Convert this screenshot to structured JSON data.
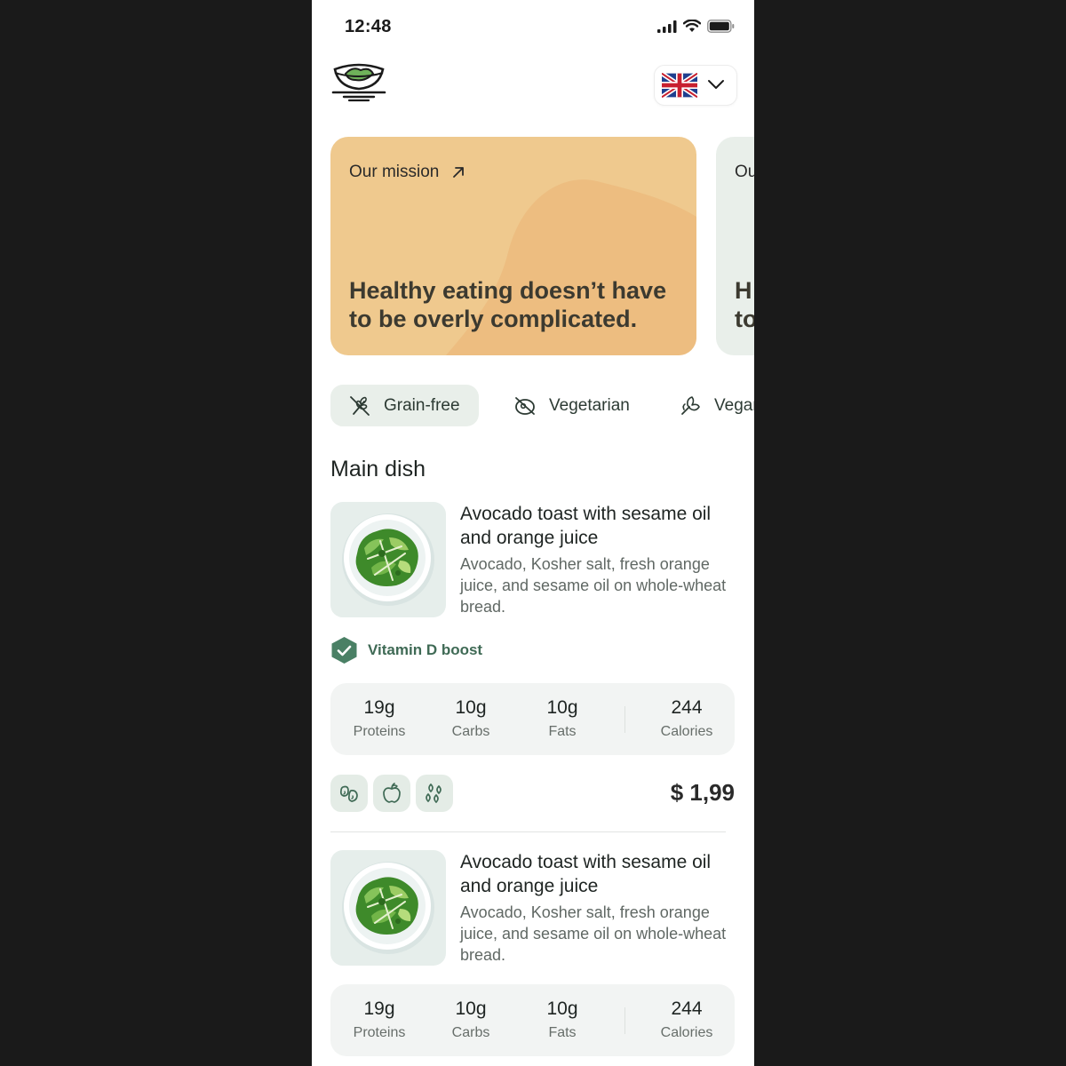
{
  "status_bar": {
    "time": "12:48",
    "icons": [
      "signal-icon",
      "wifi-icon",
      "battery-icon"
    ]
  },
  "header": {
    "logo_icon": "salad-bowl-icon",
    "language": {
      "flag_icon": "uk-flag-icon",
      "chevron_icon": "chevron-down-icon"
    }
  },
  "cards": [
    {
      "kicker": "Our mission",
      "kicker_icon": "arrow-up-right-icon",
      "headline": "Healthy eating doesn’t have to be overly complicated.",
      "color": "#efc98e"
    },
    {
      "kicker": "Ou",
      "headline": "H to",
      "color": "#e9efea"
    }
  ],
  "filters": [
    {
      "label": "Grain-free",
      "icon": "grain-free-icon",
      "active": true
    },
    {
      "label": "Vegetarian",
      "icon": "vegetarian-icon",
      "active": false
    },
    {
      "label": "Vegan",
      "icon": "vegan-icon",
      "active": false
    }
  ],
  "section": {
    "title": "Main dish"
  },
  "dishes": [
    {
      "title": "Avocado toast with sesame oil and orange juice",
      "description": "Avocado, Kosher salt, fresh orange juice, and sesame oil on whole-wheat bread.",
      "badge": {
        "label": "Vitamin D boost",
        "icon": "shield-check-icon"
      },
      "macros": [
        {
          "value": "19g",
          "label": "Proteins"
        },
        {
          "value": "10g",
          "label": "Carbs"
        },
        {
          "value": "10g",
          "label": "Fats"
        },
        {
          "value": "244",
          "label": "Calories"
        }
      ],
      "diet_icons": [
        "beans-icon",
        "apple-icon",
        "seeds-icon"
      ],
      "price": "$ 1,99"
    },
    {
      "title": "Avocado toast with sesame oil and orange juice",
      "description": "Avocado, Kosher salt, fresh orange juice, and sesame oil on whole-wheat bread.",
      "macros": [
        {
          "value": "19g",
          "label": "Proteins"
        },
        {
          "value": "10g",
          "label": "Carbs"
        },
        {
          "value": "10g",
          "label": "Fats"
        },
        {
          "value": "244",
          "label": "Calories"
        }
      ]
    }
  ],
  "colors": {
    "accent_green": "#3f6a55",
    "card_orange": "#efc98e",
    "chip_bg": "#e9efea",
    "background": "#1a1a1a"
  }
}
